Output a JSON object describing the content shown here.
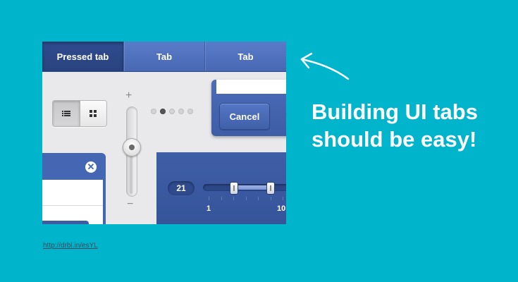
{
  "tabs": [
    {
      "label": "Pressed tab",
      "state": "pressed"
    },
    {
      "label": "Tab",
      "state": "normal"
    },
    {
      "label": "Tab",
      "state": "normal"
    }
  ],
  "view_toggle": {
    "active": "list-view",
    "options": [
      "list-view-icon",
      "grid-view-icon"
    ]
  },
  "vertical_slider": {
    "plus": "+",
    "minus": "−",
    "level": 0.45
  },
  "pagination_dots": {
    "count": 5,
    "active_index": 1
  },
  "dialog": {
    "cancel_label": "Cancel",
    "close_symbol": "✕"
  },
  "range_slider": {
    "value_label": "21",
    "tick_min_label": "1",
    "tick_max_label": "10"
  },
  "headline": {
    "line1": "Building UI tabs",
    "line2": "should be easy!"
  },
  "link": {
    "text": "http://drbl.in/esYL"
  },
  "colors": {
    "background": "#00b4cc",
    "tab_blue": "#4f70bd",
    "pressed_tab": "#2f4b8f"
  }
}
